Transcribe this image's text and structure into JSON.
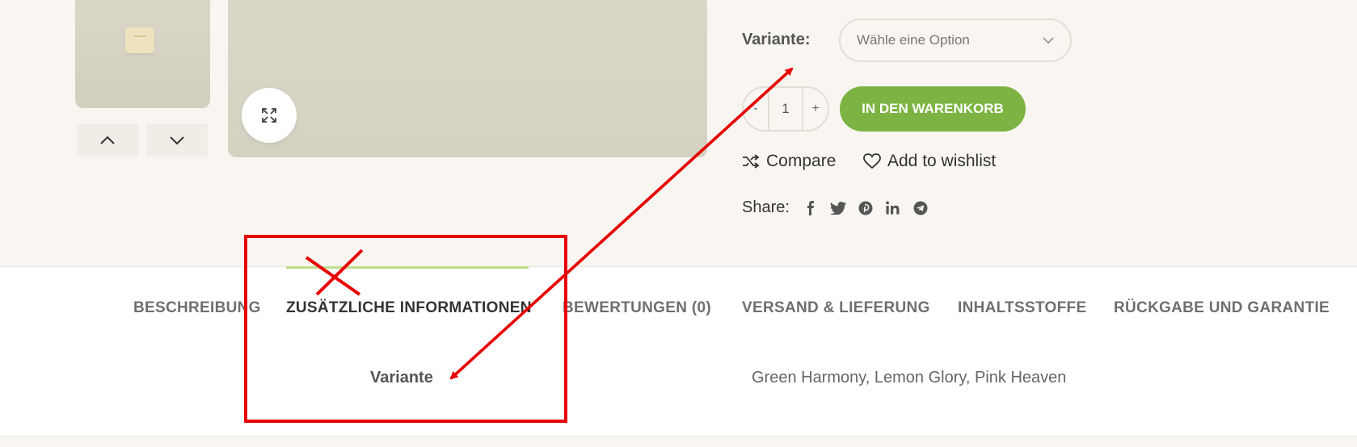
{
  "product": {
    "variant_label": "Variante",
    "variant_label_colon": ":",
    "variant_select_placeholder": "Wähle eine Option",
    "quantity": "1",
    "qty_minus": "-",
    "qty_plus": "+",
    "add_to_cart": "IN DEN WARENKORB",
    "compare": "Compare",
    "wishlist": "Add to wishlist",
    "share_label": "Share:"
  },
  "tabs": [
    {
      "label": "BESCHREIBUNG"
    },
    {
      "label": "ZUSÄTZLICHE INFORMATIONEN"
    },
    {
      "label": "BEWERTUNGEN (0)"
    },
    {
      "label": "VERSAND & LIEFERUNG"
    },
    {
      "label": "INHALTSSTOFFE"
    },
    {
      "label": "RÜCKGABE UND GARANTIE"
    }
  ],
  "additional_info": {
    "attribute_label": "Variante",
    "attribute_value": "Green Harmony, Lemon Glory, Pink Heaven"
  },
  "colors": {
    "accent_green": "#7cb342",
    "tab_indicator": "#c2dc8e",
    "annotation_red": "#e60000"
  },
  "icons": [
    "chevron-up-icon",
    "chevron-down-icon",
    "expand-icon",
    "shuffle-icon",
    "heart-icon",
    "facebook-icon",
    "twitter-icon",
    "pinterest-icon",
    "linkedin-icon",
    "telegram-icon"
  ]
}
